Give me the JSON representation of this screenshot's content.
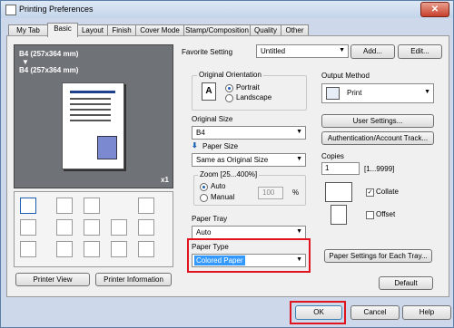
{
  "window": {
    "title": "Printing Preferences",
    "close_glyph": "✕"
  },
  "tabs": [
    "My Tab",
    "Basic",
    "Layout",
    "Finish",
    "Cover Mode",
    "Stamp/Composition",
    "Quality",
    "Other"
  ],
  "preview": {
    "label1": "B4 (257x364 mm)",
    "arrow": "▼",
    "label2": "B4 (257x364 mm)",
    "copies_badge": "x1"
  },
  "left_buttons": {
    "printer_view": "Printer View",
    "printer_info": "Printer Information"
  },
  "favorite": {
    "label": "Favorite Setting",
    "value": "Untitled",
    "add": "Add...",
    "edit": "Edit..."
  },
  "orientation": {
    "label": "Original Orientation",
    "portrait": "Portrait",
    "landscape": "Landscape",
    "selected": "Portrait"
  },
  "original_size": {
    "label": "Original Size",
    "value": "B4"
  },
  "paper_size": {
    "label": "Paper Size",
    "value": "Same as Original Size"
  },
  "zoom": {
    "label": "Zoom [25...400%]",
    "auto": "Auto",
    "manual": "Manual",
    "value": "100",
    "unit": "%"
  },
  "paper_tray": {
    "label": "Paper Tray",
    "value": "Auto"
  },
  "paper_type": {
    "label": "Paper Type",
    "value": "Colored Paper"
  },
  "output": {
    "label": "Output Method",
    "value": "Print"
  },
  "right_buttons": {
    "user_settings": "User Settings...",
    "auth": "Authentication/Account Track...",
    "paper_settings": "Paper Settings for Each Tray..."
  },
  "copies": {
    "label": "Copies",
    "value": "1",
    "range": "[1...9999]",
    "collate": "Collate",
    "offset": "Offset",
    "collate_checked": true,
    "offset_checked": false
  },
  "footer": {
    "default": "Default",
    "ok": "OK",
    "cancel": "Cancel",
    "help": "Help"
  },
  "colors": {
    "accent": "#1c5fb0",
    "highlight_box": "#e0141e",
    "selected_field": "#3399ff"
  }
}
